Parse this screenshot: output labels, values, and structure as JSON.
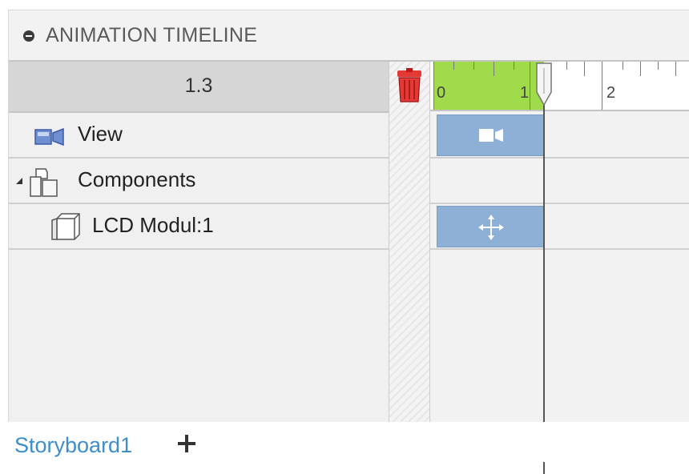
{
  "header": {
    "title": "ANIMATION TIMELINE"
  },
  "current_time": "1.3",
  "rows": [
    {
      "label": "View"
    },
    {
      "label": "Components"
    },
    {
      "label": "LCD Modul:1"
    }
  ],
  "ruler": {
    "ticks": [
      "0",
      "1",
      "2"
    ]
  },
  "footer": {
    "storyboard_tab": "Storyboard1"
  },
  "colors": {
    "played_range": "#9fdb4a",
    "action_block": "#8fb0d6",
    "storyboard_link": "#3d8ec9"
  }
}
